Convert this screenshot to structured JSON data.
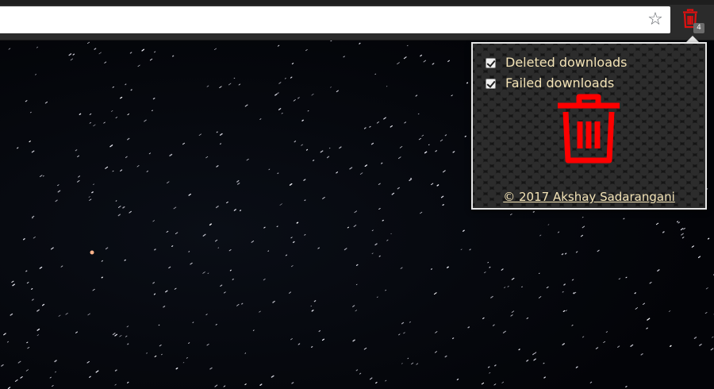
{
  "toolbar": {
    "omnibox_value": "",
    "star_icon": "star-outline-icon",
    "extension": {
      "icon": "trash-icon",
      "icon_color": "#e01010",
      "badge_count": "4",
      "badge_color": "#6b6b6b"
    }
  },
  "popup": {
    "options": [
      {
        "label": "Deleted downloads",
        "checked": true
      },
      {
        "label": "Failed downloads",
        "checked": true
      }
    ],
    "big_icon": "trash-icon",
    "accent_color": "#ff0000",
    "text_color": "#f3e3b6",
    "copyright": "© 2017 Akshay Sadarangani"
  },
  "background": {
    "description_icon": "starry-sky-image"
  }
}
